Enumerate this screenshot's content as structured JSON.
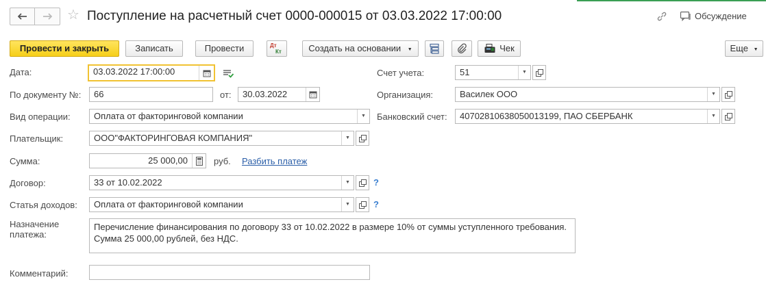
{
  "header": {
    "title": "Поступление на расчетный счет 0000-000015 от 03.03.2022 17:00:00",
    "discussion_label": "Обсуждение",
    "icons": {
      "back": "arrow-left-icon",
      "forward": "arrow-right-icon",
      "favorite": "star-icon",
      "link": "link-icon",
      "discussion": "chat-bubble-icon"
    }
  },
  "toolbar": {
    "post_close_label": "Провести и закрыть",
    "save_label": "Записать",
    "post_label": "Провести",
    "dtkt_label_top": "Дт",
    "dtkt_label_bottom": "Кт",
    "create_based_label": "Создать на основании",
    "check_label": "Чек",
    "more_label": "Еще"
  },
  "form": {
    "date": {
      "label": "Дата:",
      "value": "03.03.2022 17:00:00"
    },
    "doc_number": {
      "label": "По документу №:",
      "value": "66"
    },
    "doc_date": {
      "label": "от:",
      "value": "30.03.2022"
    },
    "operation_type": {
      "label": "Вид операции:",
      "value": "Оплата от факторинговой компании"
    },
    "payer": {
      "label": "Плательщик:",
      "value": "ООО\"ФАКТОРИНГОВАЯ КОМПАНИЯ\""
    },
    "amount": {
      "label": "Сумма:",
      "value": "25 000,00",
      "currency": "руб.",
      "split_link": "Разбить платеж"
    },
    "contract": {
      "label": "Договор:",
      "value": "33 от 10.02.2022",
      "help": "?"
    },
    "income_item": {
      "label": "Статья доходов:",
      "value": "Оплата от факторинговой компании",
      "help": "?"
    },
    "purpose": {
      "label": "Назначение платежа:",
      "value": "Перечисление финансирования по договору 33 от 10.02.2022 в размере 10% от суммы уступленного требования. Сумма 25 000,00 рублей, без НДС."
    },
    "comment": {
      "label": "Комментарий:",
      "value": ""
    },
    "account": {
      "label": "Счет учета:",
      "value": "51"
    },
    "organization": {
      "label": "Организация:",
      "value": "Василек ООО"
    },
    "bank_account": {
      "label": "Банковский счет:",
      "value": "40702810638050013199, ПАО СБЕРБАНК"
    }
  },
  "colors": {
    "primary_button": "#f6cf19",
    "focus_border": "#f1c232",
    "link": "#2a5ea8",
    "help": "#3a7fd0",
    "accent_line": "#3a9f54"
  }
}
